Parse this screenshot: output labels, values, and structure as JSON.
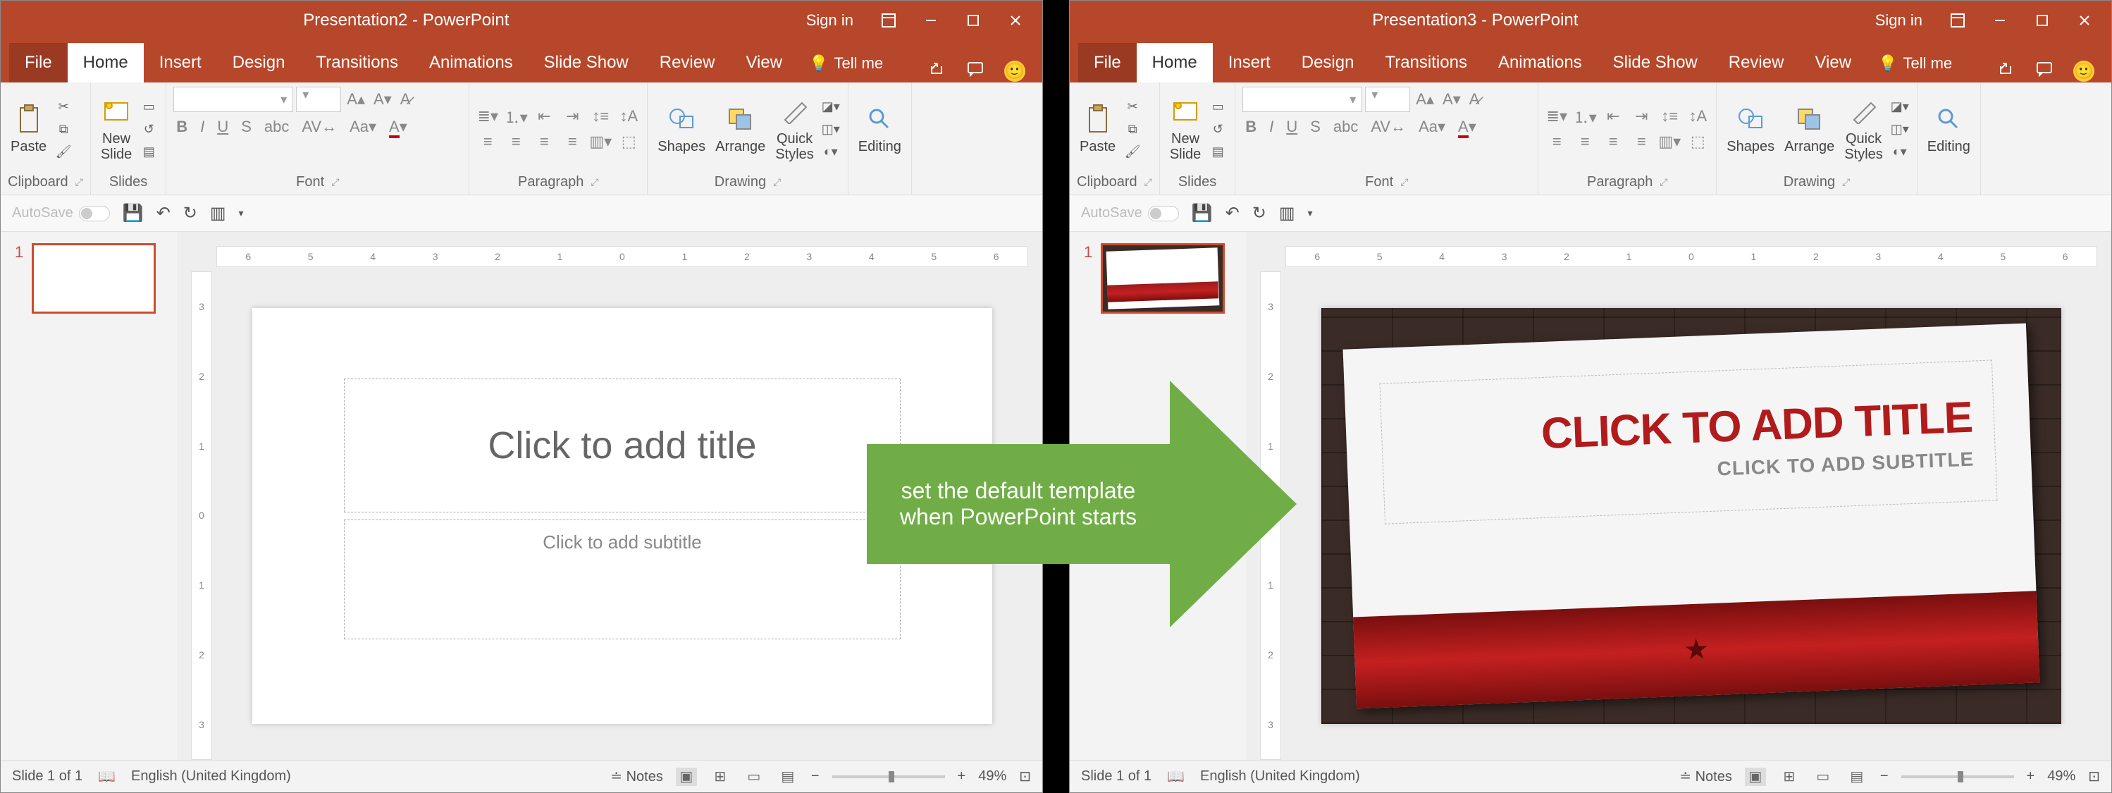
{
  "left_window": {
    "title": "Presentation2  -  PowerPoint",
    "sign_in": "Sign in",
    "tabs": {
      "file": "File",
      "home": "Home",
      "insert": "Insert",
      "design": "Design",
      "transitions": "Transitions",
      "animations": "Animations",
      "slideshow": "Slide Show",
      "review": "Review",
      "view": "View",
      "tellme": "Tell me"
    },
    "ribbon": {
      "clipboard": {
        "paste": "Paste",
        "label": "Clipboard"
      },
      "slides": {
        "new_slide": "New\nSlide",
        "label": "Slides"
      },
      "font": {
        "label": "Font",
        "name_placeholder": "",
        "size_placeholder": ""
      },
      "paragraph": {
        "label": "Paragraph"
      },
      "drawing": {
        "shapes": "Shapes",
        "arrange": "Arrange",
        "quick_styles": "Quick\nStyles",
        "label": "Drawing"
      },
      "editing": {
        "label": "Editing"
      }
    },
    "qat": {
      "autosave": "AutoSave",
      "autosave_state": "Off"
    },
    "thumb": {
      "number": "1"
    },
    "slide": {
      "title_ph": "Click to add title",
      "sub_ph": "Click to add subtitle"
    },
    "status": {
      "slide": "Slide 1 of 1",
      "lang": "English (United Kingdom)",
      "notes": "Notes",
      "zoom": "49%"
    }
  },
  "right_window": {
    "title": "Presentation3  -  PowerPoint",
    "sign_in": "Sign in",
    "tabs": {
      "file": "File",
      "home": "Home",
      "insert": "Insert",
      "design": "Design",
      "transitions": "Transitions",
      "animations": "Animations",
      "slideshow": "Slide Show",
      "review": "Review",
      "view": "View",
      "tellme": "Tell me"
    },
    "ribbon": {
      "clipboard": {
        "paste": "Paste",
        "label": "Clipboard"
      },
      "slides": {
        "new_slide": "New\nSlide",
        "label": "Slides"
      },
      "font": {
        "label": "Font",
        "name_placeholder": "",
        "size_placeholder": ""
      },
      "paragraph": {
        "label": "Paragraph"
      },
      "drawing": {
        "shapes": "Shapes",
        "arrange": "Arrange",
        "quick_styles": "Quick\nStyles",
        "label": "Drawing"
      },
      "editing": {
        "label": "Editing"
      }
    },
    "qat": {
      "autosave": "AutoSave",
      "autosave_state": "Off"
    },
    "thumb": {
      "number": "1"
    },
    "slide": {
      "title_ph": "CLICK TO ADD TITLE",
      "sub_ph": "CLICK TO ADD SUBTITLE"
    },
    "status": {
      "slide": "Slide 1 of 1",
      "lang": "English (United Kingdom)",
      "notes": "Notes",
      "zoom": "49%"
    }
  },
  "arrow": {
    "line1": "set the default template",
    "line2": "when PowerPoint starts"
  },
  "ruler_ticks": [
    "6",
    "5",
    "4",
    "3",
    "2",
    "1",
    "0",
    "1",
    "2",
    "3",
    "4",
    "5",
    "6"
  ],
  "vruler_ticks": [
    "3",
    "2",
    "1",
    "0",
    "1",
    "2",
    "3"
  ]
}
